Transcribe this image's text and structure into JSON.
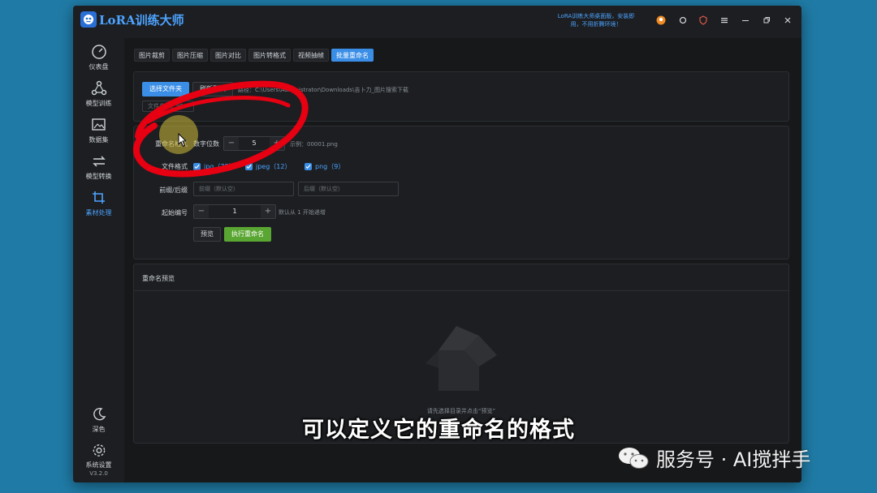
{
  "app": {
    "title": "LoRA训练大师",
    "notice": "LoRA训练大师桌面版，安装即用，不用折腾环境！"
  },
  "titlebar_icons": [
    "avatar-icon",
    "refresh-icon",
    "shield-icon",
    "menu-icon",
    "minimize-icon",
    "restore-icon",
    "close-icon"
  ],
  "sidebar": {
    "items": [
      {
        "label": "仪表盘",
        "icon": "gauge-icon"
      },
      {
        "label": "模型训练",
        "icon": "nodes-icon"
      },
      {
        "label": "数据集",
        "icon": "images-icon"
      },
      {
        "label": "模型转换",
        "icon": "swap-icon"
      },
      {
        "label": "素材处理",
        "icon": "crop-icon"
      }
    ],
    "theme_label": "深色",
    "settings_label": "系统设置",
    "version": "V3.2.0"
  },
  "tabs": [
    {
      "label": "图片裁剪",
      "active": false
    },
    {
      "label": "图片压缩",
      "active": false
    },
    {
      "label": "图片对比",
      "active": false
    },
    {
      "label": "图片转格式",
      "active": false
    },
    {
      "label": "视频抽帧",
      "active": false
    },
    {
      "label": "批量重命名",
      "active": true
    }
  ],
  "folder": {
    "select_button": "选择文件夹",
    "refresh_button": "刷新列表",
    "path": "路径：C:\\Users\\Administrator\\Downloads\\吉卜力_图片搜索下载",
    "file_count_label": "文件总数：99"
  },
  "form": {
    "format_label": "重命名格式",
    "digits_label": "数字位数",
    "digits_value": "5",
    "example": "示例：00001.png",
    "file_format_label": "文件格式",
    "formats": [
      {
        "label": "jpg（78）",
        "checked": true
      },
      {
        "label": "jpeg（12）",
        "checked": true
      },
      {
        "label": "png（9）",
        "checked": true
      }
    ],
    "prefix_suffix_label": "前缀/后缀",
    "prefix_placeholder": "前缀（默认空）",
    "suffix_placeholder": "后缀（默认空）",
    "start_label": "起始编号",
    "start_value": "1",
    "start_hint": "默认从 1 开始递增",
    "preview_button": "预览",
    "execute_button": "执行重命名"
  },
  "preview": {
    "title": "重命名预览",
    "empty_text": "请先选择目录并点击“预览”"
  },
  "overlay": {
    "subtitle": "可以定义它的重命名的格式",
    "watermark": "服务号 · AI搅拌手"
  },
  "colors": {
    "accent": "#3a8ee6",
    "success": "#5aa632",
    "annotation": "#e60012"
  }
}
